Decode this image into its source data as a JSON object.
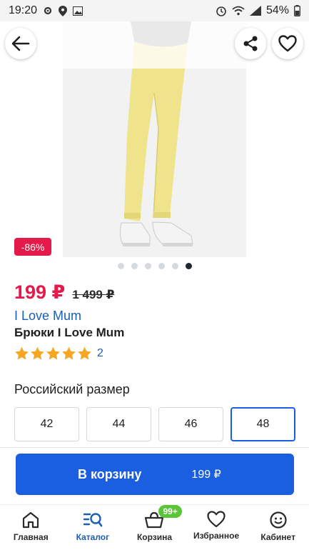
{
  "status_bar": {
    "time": "19:20",
    "battery": "54%",
    "icons": [
      "gear-icon",
      "location-icon",
      "image-icon",
      "alarm-icon",
      "wifi-icon",
      "signal-icon",
      "battery-icon"
    ]
  },
  "header": {
    "back_icon": "back-arrow-icon",
    "share_icon": "share-icon",
    "favorite_icon": "heart-icon"
  },
  "product": {
    "discount": "-86%",
    "price": "199 ₽",
    "old_price": "1 499 ₽",
    "brand": "I Love Mum",
    "title": "Брюки I Love Mum",
    "rating_stars": 5,
    "reviews_count": "2",
    "gallery": {
      "total": 6,
      "active_index": 5
    }
  },
  "sizes": {
    "label": "Российский размер",
    "options": [
      "42",
      "44",
      "46",
      "48"
    ],
    "selected": "48"
  },
  "cart": {
    "label": "В корзину",
    "sum": "199 ₽"
  },
  "nav": {
    "items": [
      {
        "label": "Главная",
        "icon": "home-icon"
      },
      {
        "label": "Каталог",
        "icon": "catalog-search-icon"
      },
      {
        "label": "Корзина",
        "icon": "basket-icon",
        "badge": "99+"
      },
      {
        "label": "Избранное",
        "icon": "heart-icon"
      },
      {
        "label": "Кабинет",
        "icon": "smiley-icon"
      }
    ],
    "active": "Каталог"
  },
  "colors": {
    "accent_blue": "#1a5fe0",
    "price_red": "#e5194a",
    "brand_blue": "#1a5fb4",
    "star": "#f5a623",
    "badge_green": "#5bc53a"
  }
}
